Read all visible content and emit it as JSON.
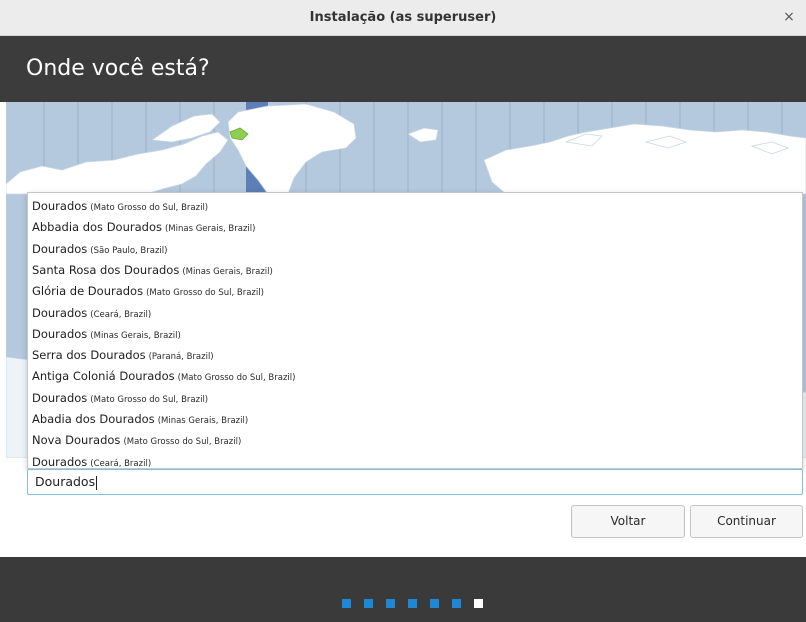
{
  "window": {
    "title": "Instalação (as superuser)",
    "close_glyph": "×"
  },
  "page": {
    "heading": "Onde você está?"
  },
  "map": {
    "ocean_color": "#b4c8de",
    "land_color": "#ffffff",
    "highlight_zone_color": "#5b7fb6",
    "highlight_region_color": "#8fcf4f"
  },
  "suggestions": [
    {
      "name": "Dourados",
      "region": "(Mato Grosso do Sul, Brazil)"
    },
    {
      "name": "Abbadia dos Dourados",
      "region": "(Minas Gerais, Brazil)"
    },
    {
      "name": "Dourados",
      "region": "(São Paulo, Brazil)"
    },
    {
      "name": "Santa Rosa dos Dourados",
      "region": "(Minas Gerais, Brazil)"
    },
    {
      "name": "Glória de Dourados",
      "region": "(Mato Grosso do Sul, Brazil)"
    },
    {
      "name": "Dourados",
      "region": "(Ceará, Brazil)"
    },
    {
      "name": "Dourados",
      "region": "(Minas Gerais, Brazil)"
    },
    {
      "name": "Serra dos Dourados",
      "region": "(Paraná, Brazil)"
    },
    {
      "name": "Antiga Coloniá Dourados",
      "region": "(Mato Grosso do Sul, Brazil)"
    },
    {
      "name": "Dourados",
      "region": "(Mato Grosso do Sul, Brazil)"
    },
    {
      "name": "Abadia dos Dourados",
      "region": "(Minas Gerais, Brazil)"
    },
    {
      "name": "Nova Dourados",
      "region": "(Mato Grosso do Sul, Brazil)"
    },
    {
      "name": "Dourados",
      "region": "(Ceará, Brazil)"
    }
  ],
  "location_input": {
    "value": "Dourados"
  },
  "buttons": {
    "back": "Voltar",
    "continue": "Continuar"
  },
  "progress": {
    "total_steps": 7,
    "current_step": 7,
    "done_color": "#1e88d6",
    "current_color": "#ffffff"
  }
}
